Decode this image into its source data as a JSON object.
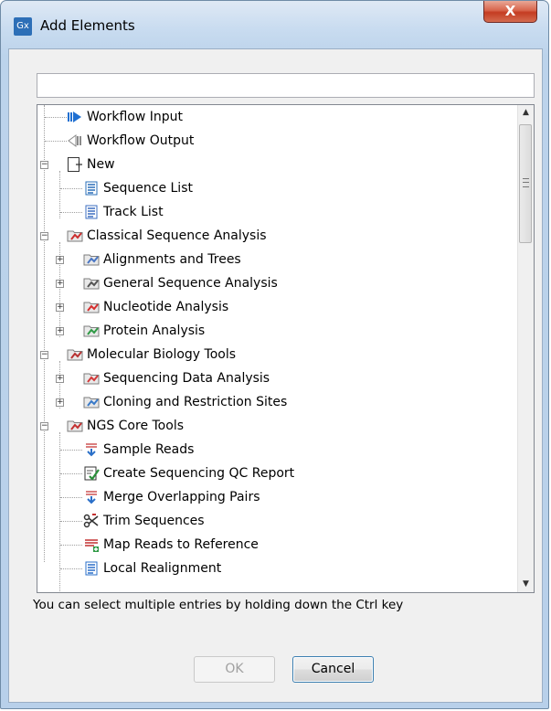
{
  "window": {
    "title": "Add Elements",
    "app_icon_text": "Gx",
    "close_glyph": "X"
  },
  "search": {
    "value": "",
    "placeholder": ""
  },
  "tree": [
    {
      "label": "Workflow Input",
      "icon": "workflow-input-icon",
      "color": "#1f6fd1"
    },
    {
      "label": "Workflow Output",
      "icon": "workflow-output-icon",
      "color": "#8a8a8a"
    },
    {
      "label": "New",
      "icon": "new-folder-icon",
      "color": "#555555"
    },
    {
      "label": "Sequence List",
      "icon": "sequence-list-icon",
      "color": "#2a6fb8"
    },
    {
      "label": "Track List",
      "icon": "track-list-icon",
      "color": "#3d6fc1"
    },
    {
      "label": "Classical Sequence Analysis",
      "icon": "classical-analysis-folder-icon",
      "color": "#cc2e2e"
    },
    {
      "label": "Alignments and Trees",
      "icon": "alignments-folder-icon",
      "color": "#4a76c4"
    },
    {
      "label": "General Sequence Analysis",
      "icon": "general-analysis-folder-icon",
      "color": "#555555"
    },
    {
      "label": "Nucleotide Analysis",
      "icon": "nucleotide-folder-icon",
      "color": "#d62f2f"
    },
    {
      "label": "Protein Analysis",
      "icon": "protein-folder-icon",
      "color": "#2f9a45"
    },
    {
      "label": "Molecular Biology Tools",
      "icon": "molecular-tools-folder-icon",
      "color": "#b83232"
    },
    {
      "label": "Sequencing Data Analysis",
      "icon": "sequencing-data-folder-icon",
      "color": "#d23a3a"
    },
    {
      "label": "Cloning and Restriction Sites",
      "icon": "cloning-folder-icon",
      "color": "#3a7ac8"
    },
    {
      "label": "NGS Core Tools",
      "icon": "ngs-folder-icon",
      "color": "#c43131"
    },
    {
      "label": "Sample Reads",
      "icon": "sample-reads-icon",
      "color": "#2a6fc8"
    },
    {
      "label": "Create Sequencing QC Report",
      "icon": "qc-report-icon",
      "color": "#2a8f3a"
    },
    {
      "label": "Merge Overlapping Pairs",
      "icon": "merge-pairs-icon",
      "color": "#2a6fc8"
    },
    {
      "label": "Trim Sequences",
      "icon": "trim-sequences-icon",
      "color": "#c43131"
    },
    {
      "label": "Map Reads to Reference",
      "icon": "map-reads-icon",
      "color": "#c43131"
    },
    {
      "label": "Local Realignment",
      "icon": "local-realignment-icon",
      "color": "#2a6fc8"
    }
  ],
  "hint": "You can select multiple entries by holding down the Ctrl key",
  "buttons": {
    "ok": "OK",
    "cancel": "Cancel"
  },
  "scroll_up_glyph": "▲",
  "scroll_down_glyph": "▼"
}
